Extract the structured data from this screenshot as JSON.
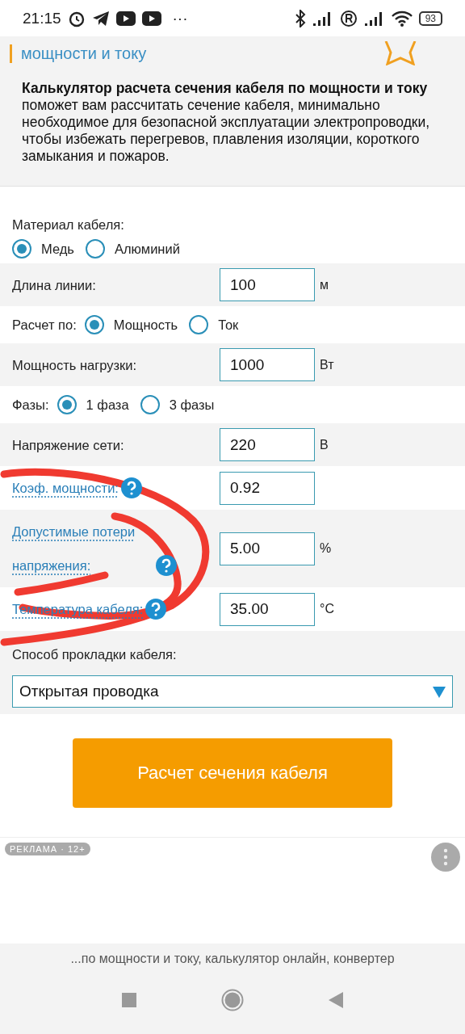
{
  "status_bar": {
    "time": "21:15",
    "more": "···",
    "battery": "93"
  },
  "header": {
    "title": "мощности и току"
  },
  "description": {
    "text": "**Калькулятор расчета сечения кабеля по мощности и току** поможет вам рассчитать сечение кабеля, минимально необходимое для безопасной эксплуатации электропроводки, чтобы избежать перегревов, плавления изоляции, короткого замыкания и пожаров."
  },
  "form": {
    "rows": [
      {
        "kind": "radio_stacked",
        "label": "Материал кабеля:",
        "options": [
          {
            "label": "Медь",
            "selected": true
          },
          {
            "label": "Алюминий",
            "selected": false
          }
        ]
      },
      {
        "kind": "input",
        "label": "Длина линии:",
        "value": "100",
        "unit": "м",
        "help": false
      },
      {
        "kind": "radio_inline",
        "label": "Расчет по:",
        "options": [
          {
            "label": "Мощность",
            "selected": true
          },
          {
            "label": "Ток",
            "selected": false
          }
        ]
      },
      {
        "kind": "input",
        "label": "Мощность нагрузки:",
        "value": "1000",
        "unit": "Вт",
        "help": false
      },
      {
        "kind": "radio_inline",
        "label": "Фазы:",
        "options": [
          {
            "label": "1 фаза",
            "selected": true
          },
          {
            "label": "3 фазы",
            "selected": false
          }
        ]
      },
      {
        "kind": "input",
        "label": "Напряжение сети:",
        "value": "220",
        "unit": "В",
        "help": false
      },
      {
        "kind": "input",
        "label": "Коэф. мощности:",
        "value": "0.92",
        "help": true
      },
      {
        "kind": "input",
        "label": "Допустимые потери напряжения:",
        "value": "5.00",
        "unit": "%",
        "help": true
      },
      {
        "kind": "input",
        "label": "Температура кабеля:",
        "value": "35.00",
        "unit": "°C",
        "help": true
      },
      {
        "kind": "select",
        "label": "Способ прокладки кабеля:",
        "value": "Открытая проводка"
      }
    ]
  },
  "button": {
    "label": "Расчет сечения кабеля"
  },
  "ad": {
    "badge": "РЕКЛАМА · 12+"
  },
  "browser_bar": {
    "text": "...по мощности и току, калькулятор онлайн, конвертер"
  }
}
